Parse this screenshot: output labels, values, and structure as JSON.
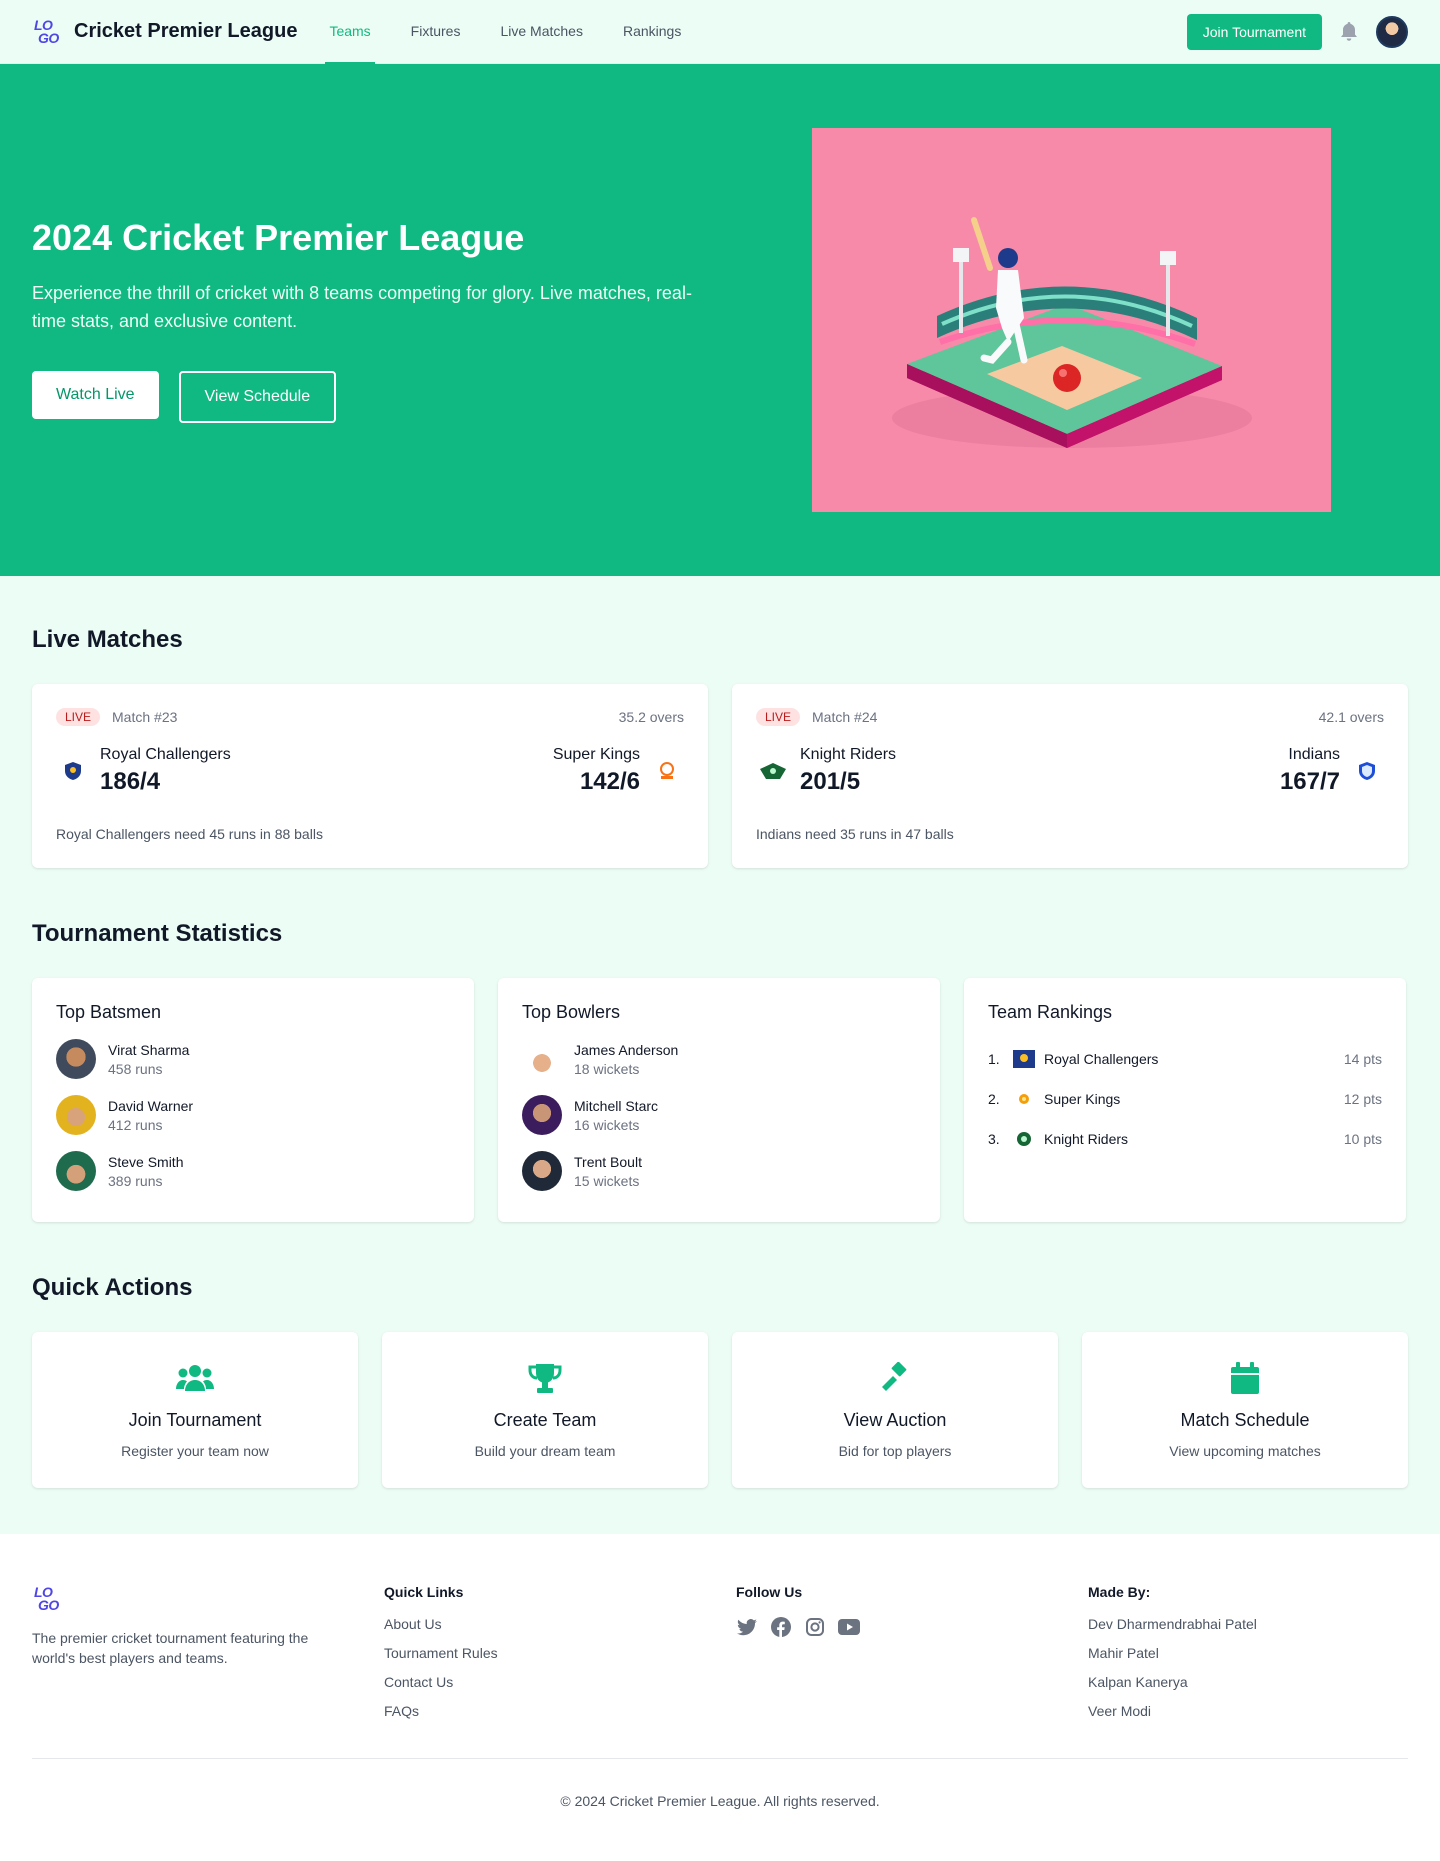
{
  "nav": {
    "brand": "Cricket Premier League",
    "links": [
      "Teams",
      "Fixtures",
      "Live Matches",
      "Rankings"
    ],
    "join_label": "Join Tournament",
    "logo_text_1": "LO",
    "logo_text_2": "GO"
  },
  "hero": {
    "title": "2024 Cricket Premier League",
    "subtitle": "Experience the thrill of cricket with 8 teams competing for glory. Live matches, real-time stats, and exclusive content.",
    "watch_label": "Watch Live",
    "schedule_label": "View Schedule"
  },
  "live": {
    "title": "Live Matches",
    "matches": [
      {
        "badge": "LIVE",
        "match_no": "Match #23",
        "overs": "35.2 overs",
        "team1": "Royal Challengers",
        "score1": "186/4",
        "team2": "Super Kings",
        "score2": "142/6",
        "note": "Royal Challengers need 45 runs in 88 balls"
      },
      {
        "badge": "LIVE",
        "match_no": "Match #24",
        "overs": "42.1 overs",
        "team1": "Knight Riders",
        "score1": "201/5",
        "team2": "Indians",
        "score2": "167/7",
        "note": "Indians need 35 runs in 47 balls"
      }
    ]
  },
  "stats": {
    "title": "Tournament Statistics",
    "batsmen_title": "Top Batsmen",
    "batsmen": [
      {
        "name": "Virat Sharma",
        "stat": "458 runs"
      },
      {
        "name": "David Warner",
        "stat": "412 runs"
      },
      {
        "name": "Steve Smith",
        "stat": "389 runs"
      }
    ],
    "bowlers_title": "Top Bowlers",
    "bowlers": [
      {
        "name": "James Anderson",
        "stat": "18 wickets"
      },
      {
        "name": "Mitchell Starc",
        "stat": "16 wickets"
      },
      {
        "name": "Trent Boult",
        "stat": "15 wickets"
      }
    ],
    "rankings_title": "Team Rankings",
    "rankings": [
      {
        "rank": "1.",
        "team": "Royal Challengers",
        "pts": "14 pts"
      },
      {
        "rank": "2.",
        "team": "Super Kings",
        "pts": "12 pts"
      },
      {
        "rank": "3.",
        "team": "Knight Riders",
        "pts": "10 pts"
      }
    ]
  },
  "actions": {
    "title": "Quick Actions",
    "items": [
      {
        "name": "Join Tournament",
        "desc": "Register your team now"
      },
      {
        "name": "Create Team",
        "desc": "Build your dream team"
      },
      {
        "name": "View Auction",
        "desc": "Bid for top players"
      },
      {
        "name": "Match Schedule",
        "desc": "View upcoming matches"
      }
    ]
  },
  "footer": {
    "description": "The premier cricket tournament featuring the world's best players and teams.",
    "quick_links_title": "Quick Links",
    "quick_links": [
      "About Us",
      "Tournament Rules",
      "Contact Us",
      "FAQs"
    ],
    "follow_title": "Follow Us",
    "made_by_title": "Made By:",
    "makers": [
      "Dev Dharmendrabhai Patel",
      "Mahir Patel",
      "Kalpan Kanerya",
      "Veer Modi"
    ],
    "copyright": "© 2024 Cricket Premier League. All rights reserved."
  },
  "colors": {
    "primary": "#10b981",
    "hero_image_bg": "#f78aa9",
    "live_badge": "#fee2e2",
    "logo": "#4f46e5"
  }
}
